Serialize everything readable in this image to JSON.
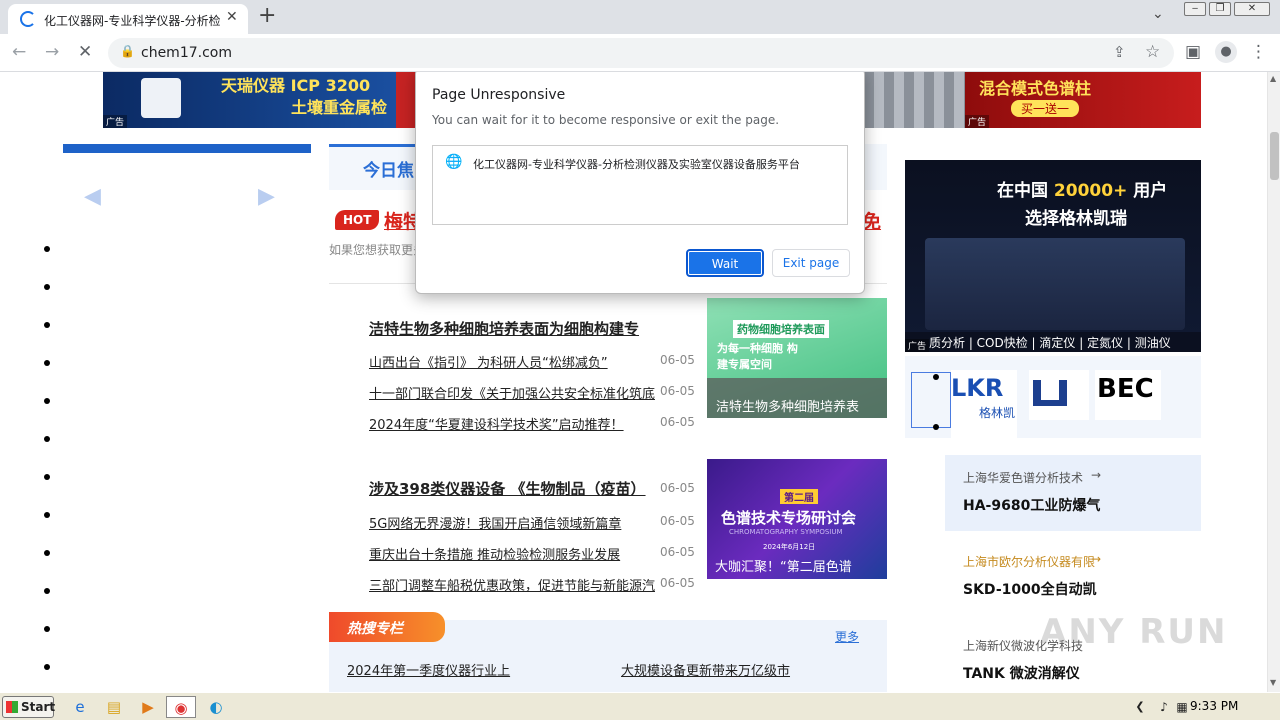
{
  "browser": {
    "tab_title": "化工仪器网-专业科学仪器-分析检测",
    "tab_close": "✕",
    "new_tab": "+",
    "tab_search": "⌄",
    "win_min": "‒",
    "win_max": "❐",
    "win_close": "✕",
    "back": "←",
    "forward": "→",
    "stop": "✕",
    "url": "chem17.com",
    "share": "⇪",
    "star": "☆",
    "sidepanel": "▣",
    "profile": "●",
    "menu": "⋮"
  },
  "banner": {
    "ad1_line1": "天瑞仪器 ICP 3200",
    "ad1_line2": "土壤重金属检",
    "ad_label": "广告",
    "ad3_line1": "混合模式色谱柱",
    "ad3_line2": "买一送一"
  },
  "left": {
    "arrow_left": "◀",
    "arrow_right": "▶",
    "bullets": 12
  },
  "center": {
    "tab_label": "今日焦",
    "hot_badge": "HOT",
    "hot_headline_start": "梅特",
    "hot_headline_end": "免",
    "subscribe_text": "如果您想获取更多",
    "block1": {
      "title": "洁特生物多种细胞培养表面为细胞构建专",
      "items": [
        {
          "text": "山西出台《指引》 为科研人员“松绑减负”",
          "date": "06-05"
        },
        {
          "text": "十一部门联合印发《关于加强公共安全标准化筑底",
          "date": "06-05"
        },
        {
          "text": "2024年度“华夏建设科学技术奖”启动推荐！",
          "date": "06-05"
        }
      ],
      "image_caption": "洁特生物多种细胞培养表",
      "image_tag": "药物细胞培养表面",
      "image_sub": "为每一种细胞 构建专属空间"
    },
    "block2": {
      "title": "涉及398类仪器设备 《生物制品（疫苗）",
      "title_date": "06-05",
      "items": [
        {
          "text": "5G网络无界漫游！我国开启通信领域新篇章",
          "date": "06-05"
        },
        {
          "text": "重庆出台十条措施 推动检验检测服务业发展",
          "date": "06-05"
        },
        {
          "text": "三部门调整车船税优惠政策，促进节能与新能源汽",
          "date": "06-05"
        }
      ],
      "image_badge": "第二届",
      "image_title": "色谱技术专场研讨会",
      "image_en": "CHROMATOGRAPHY SYMPOSIUM",
      "image_date": "2024年6月12日",
      "image_caption": "大咖汇聚！“第二届色谱"
    },
    "hot_column": {
      "label": "热搜专栏",
      "more": "更多",
      "links": [
        "2024年第一季度仪器行业上",
        "大规模设备更新带来万亿级市"
      ]
    }
  },
  "right": {
    "ad_line1": "在中国",
    "ad_highlight": "20000+",
    "ad_line1_end": "用户",
    "ad_line2": "选择格林凯瑞",
    "ad_label": "广告",
    "ad_footer": "质分析 | COD快检 | 滴定仪 | 定氮仪 | 测油仪",
    "logo1": "LKR",
    "logo1_sub": "格林凯",
    "logo3": "BEC",
    "card1_company": "上海华爱色谱分析技术",
    "card1_product": "HA-9680工业防爆气",
    "card2_company": "上海市欧尔分析仪器有限",
    "card2_product": "SKD-1000全自动凯",
    "card3_company": "上海新仪微波化学科技",
    "card3_product": "TANK 微波消解仪",
    "arrow": "→"
  },
  "dialog": {
    "title": "Page Unresponsive",
    "message": "You can wait for it to become responsive or exit the page.",
    "page_title": "化工仪器网-专业科学仪器-分析检测仪器及实验室仪器设备服务平台",
    "wait": "Wait",
    "exit": "Exit page"
  },
  "taskbar": {
    "start": "Start",
    "clock": "9:33 PM",
    "watermark": "ANY RUN"
  },
  "colors": {
    "accent_blue": "#1a73e8",
    "hot_red": "#d9251d",
    "site_blue": "#2b6fd6"
  }
}
